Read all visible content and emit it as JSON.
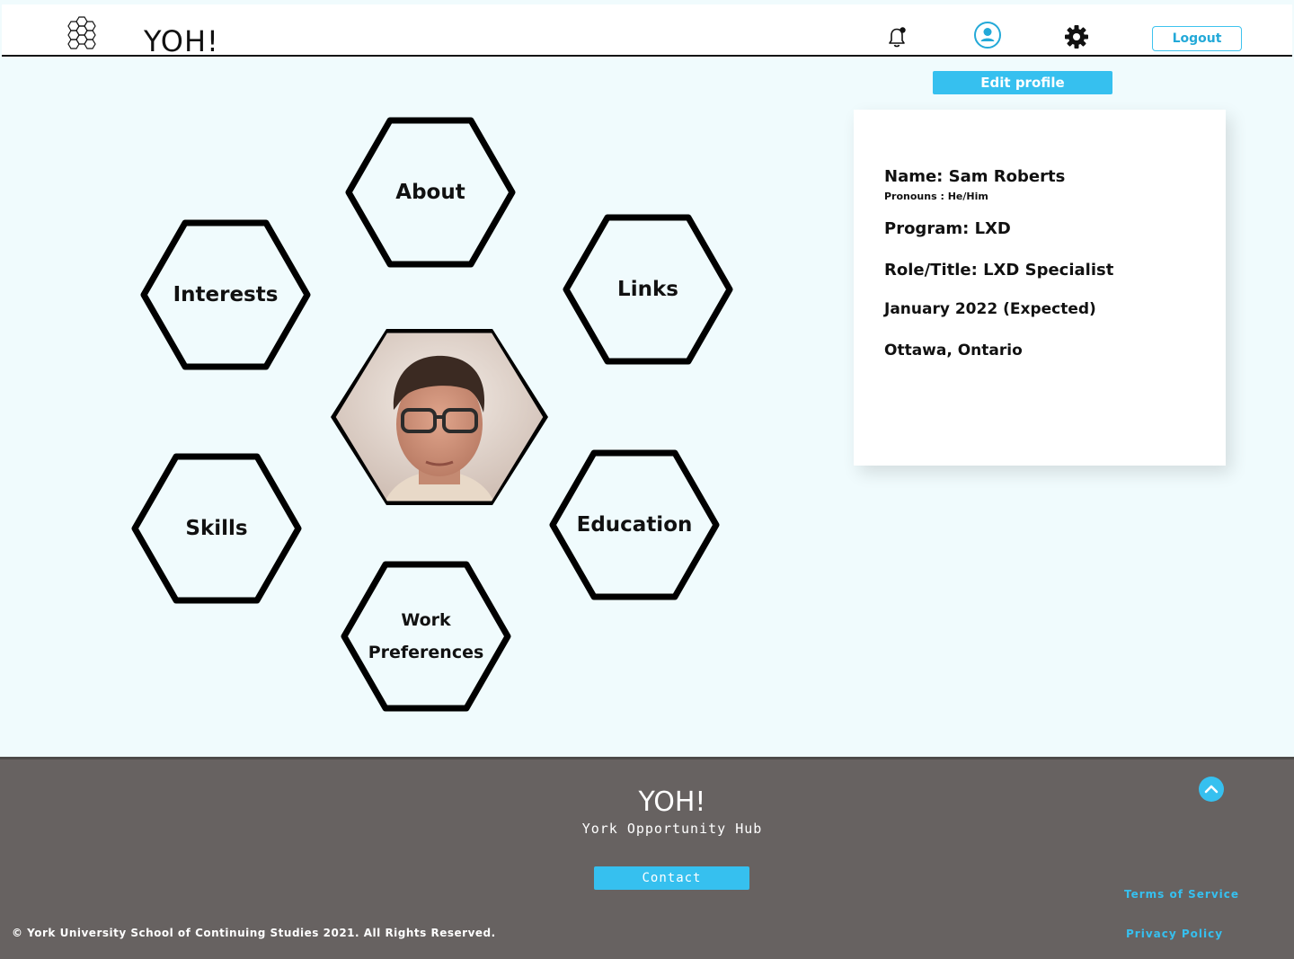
{
  "header": {
    "brand": "YOH!",
    "logo_icon": "honeycomb-logo-icon",
    "icons": [
      "bell-notification-icon",
      "user-profile-icon",
      "gear-settings-icon"
    ],
    "logout_label": "Logout"
  },
  "hex_menu": {
    "items": [
      {
        "id": "about",
        "label": "About"
      },
      {
        "id": "interests",
        "label": "Interests"
      },
      {
        "id": "links",
        "label": "Links"
      },
      {
        "id": "skills",
        "label": "Skills"
      },
      {
        "id": "education",
        "label": "Education"
      },
      {
        "id": "work-preferences",
        "label_line1": "Work",
        "label_line2": "Preferences"
      }
    ],
    "profile_photo": "profile-photo"
  },
  "profile": {
    "edit_label": "Edit profile",
    "name": "Name: Sam Roberts",
    "pronouns": "Pronouns : He/Him",
    "program": "Program: LXD",
    "role": "Role/Title: LXD Specialist",
    "date": "January 2022 (Expected)",
    "location": "Ottawa, Ontario"
  },
  "footer": {
    "brand": "YOH!",
    "subtitle": "York Opportunity Hub",
    "contact_label": "Contact",
    "scroll_top_icon": "chevron-up-icon",
    "copyright": "© York University School of Continuing Studies 2021. All Rights Reserved.",
    "terms_label": "Terms of Service",
    "privacy_label": "Privacy Policy"
  },
  "colors": {
    "page_bg": "#f0fbfd",
    "accent": "#36c0ef",
    "footer_bg": "#676261"
  }
}
